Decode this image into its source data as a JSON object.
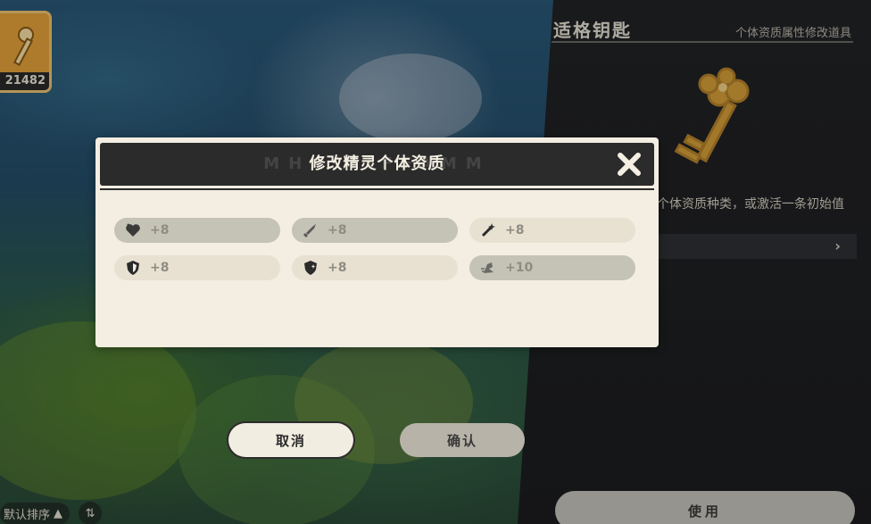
{
  "side_panel": {
    "title": "适格钥匙",
    "subtitle": "个体资质属性修改道具",
    "description": "个体资质种类，或激活一条初始值",
    "row_arrow": "›",
    "use_label": "使用"
  },
  "item_chip": {
    "count": "21482"
  },
  "sort": {
    "label": "默认排序",
    "swap_symbol": "⇅"
  },
  "modal": {
    "title": "修改精灵个体资质",
    "title_shadow": "MHX  TIFFAMM",
    "close_symbol": "✕"
  },
  "stats": [
    {
      "icon": "heart-icon",
      "value": "+8",
      "style": "grey"
    },
    {
      "icon": "sword-icon",
      "value": "+8",
      "style": "grey"
    },
    {
      "icon": "magic-wand-icon",
      "value": "+8",
      "style": "light"
    },
    {
      "icon": "shield-icon",
      "value": "+8",
      "style": "light"
    },
    {
      "icon": "magic-shield-icon",
      "value": "+8",
      "style": "light"
    },
    {
      "icon": "speed-boot-icon",
      "value": "+10",
      "style": "grey"
    }
  ],
  "buttons": {
    "cancel_label": "取消",
    "confirm_label": "确认"
  },
  "colors": {
    "modal_bg": "#f3ede2",
    "header_bg": "#2b2b2b",
    "pill_grey": "#c5c2b6",
    "pill_light": "#e8e1d2",
    "key_gold": "#d9a23a"
  }
}
